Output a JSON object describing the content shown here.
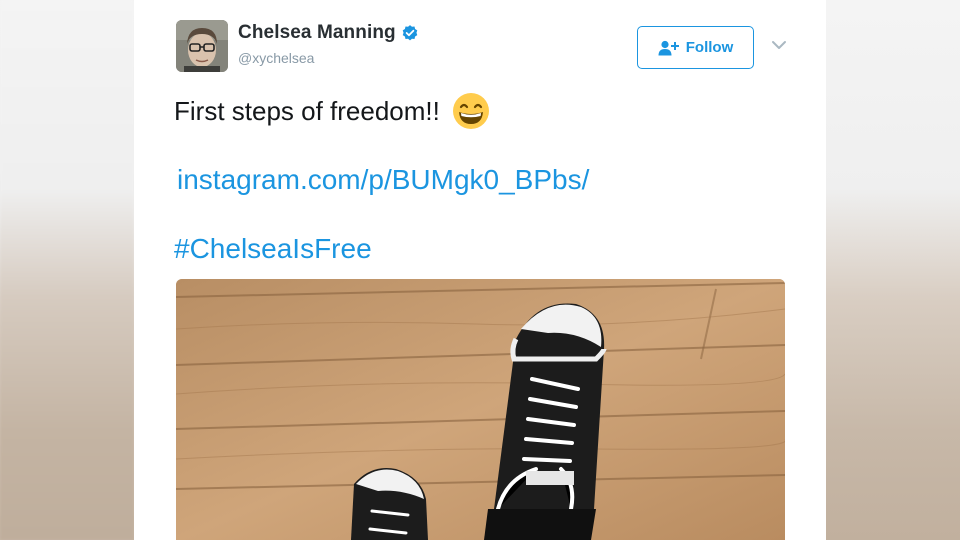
{
  "tweet": {
    "display_name": "Chelsea Manning",
    "handle": "@xychelsea",
    "follow_label": "Follow",
    "text": "First steps of freedom!!",
    "link": "instagram.com/p/BUMgk0_BPbs/",
    "hashtag": "#ChelseaIsFree"
  },
  "icons": {
    "verified": "verified-badge-icon",
    "follow": "add-person-icon",
    "more": "chevron-down-icon",
    "emoji": "grinning-face-emoji"
  },
  "colors": {
    "accent": "#1b95e0",
    "name_text": "#292f33",
    "handle_text": "#8899a6",
    "body_text": "#14171a"
  }
}
